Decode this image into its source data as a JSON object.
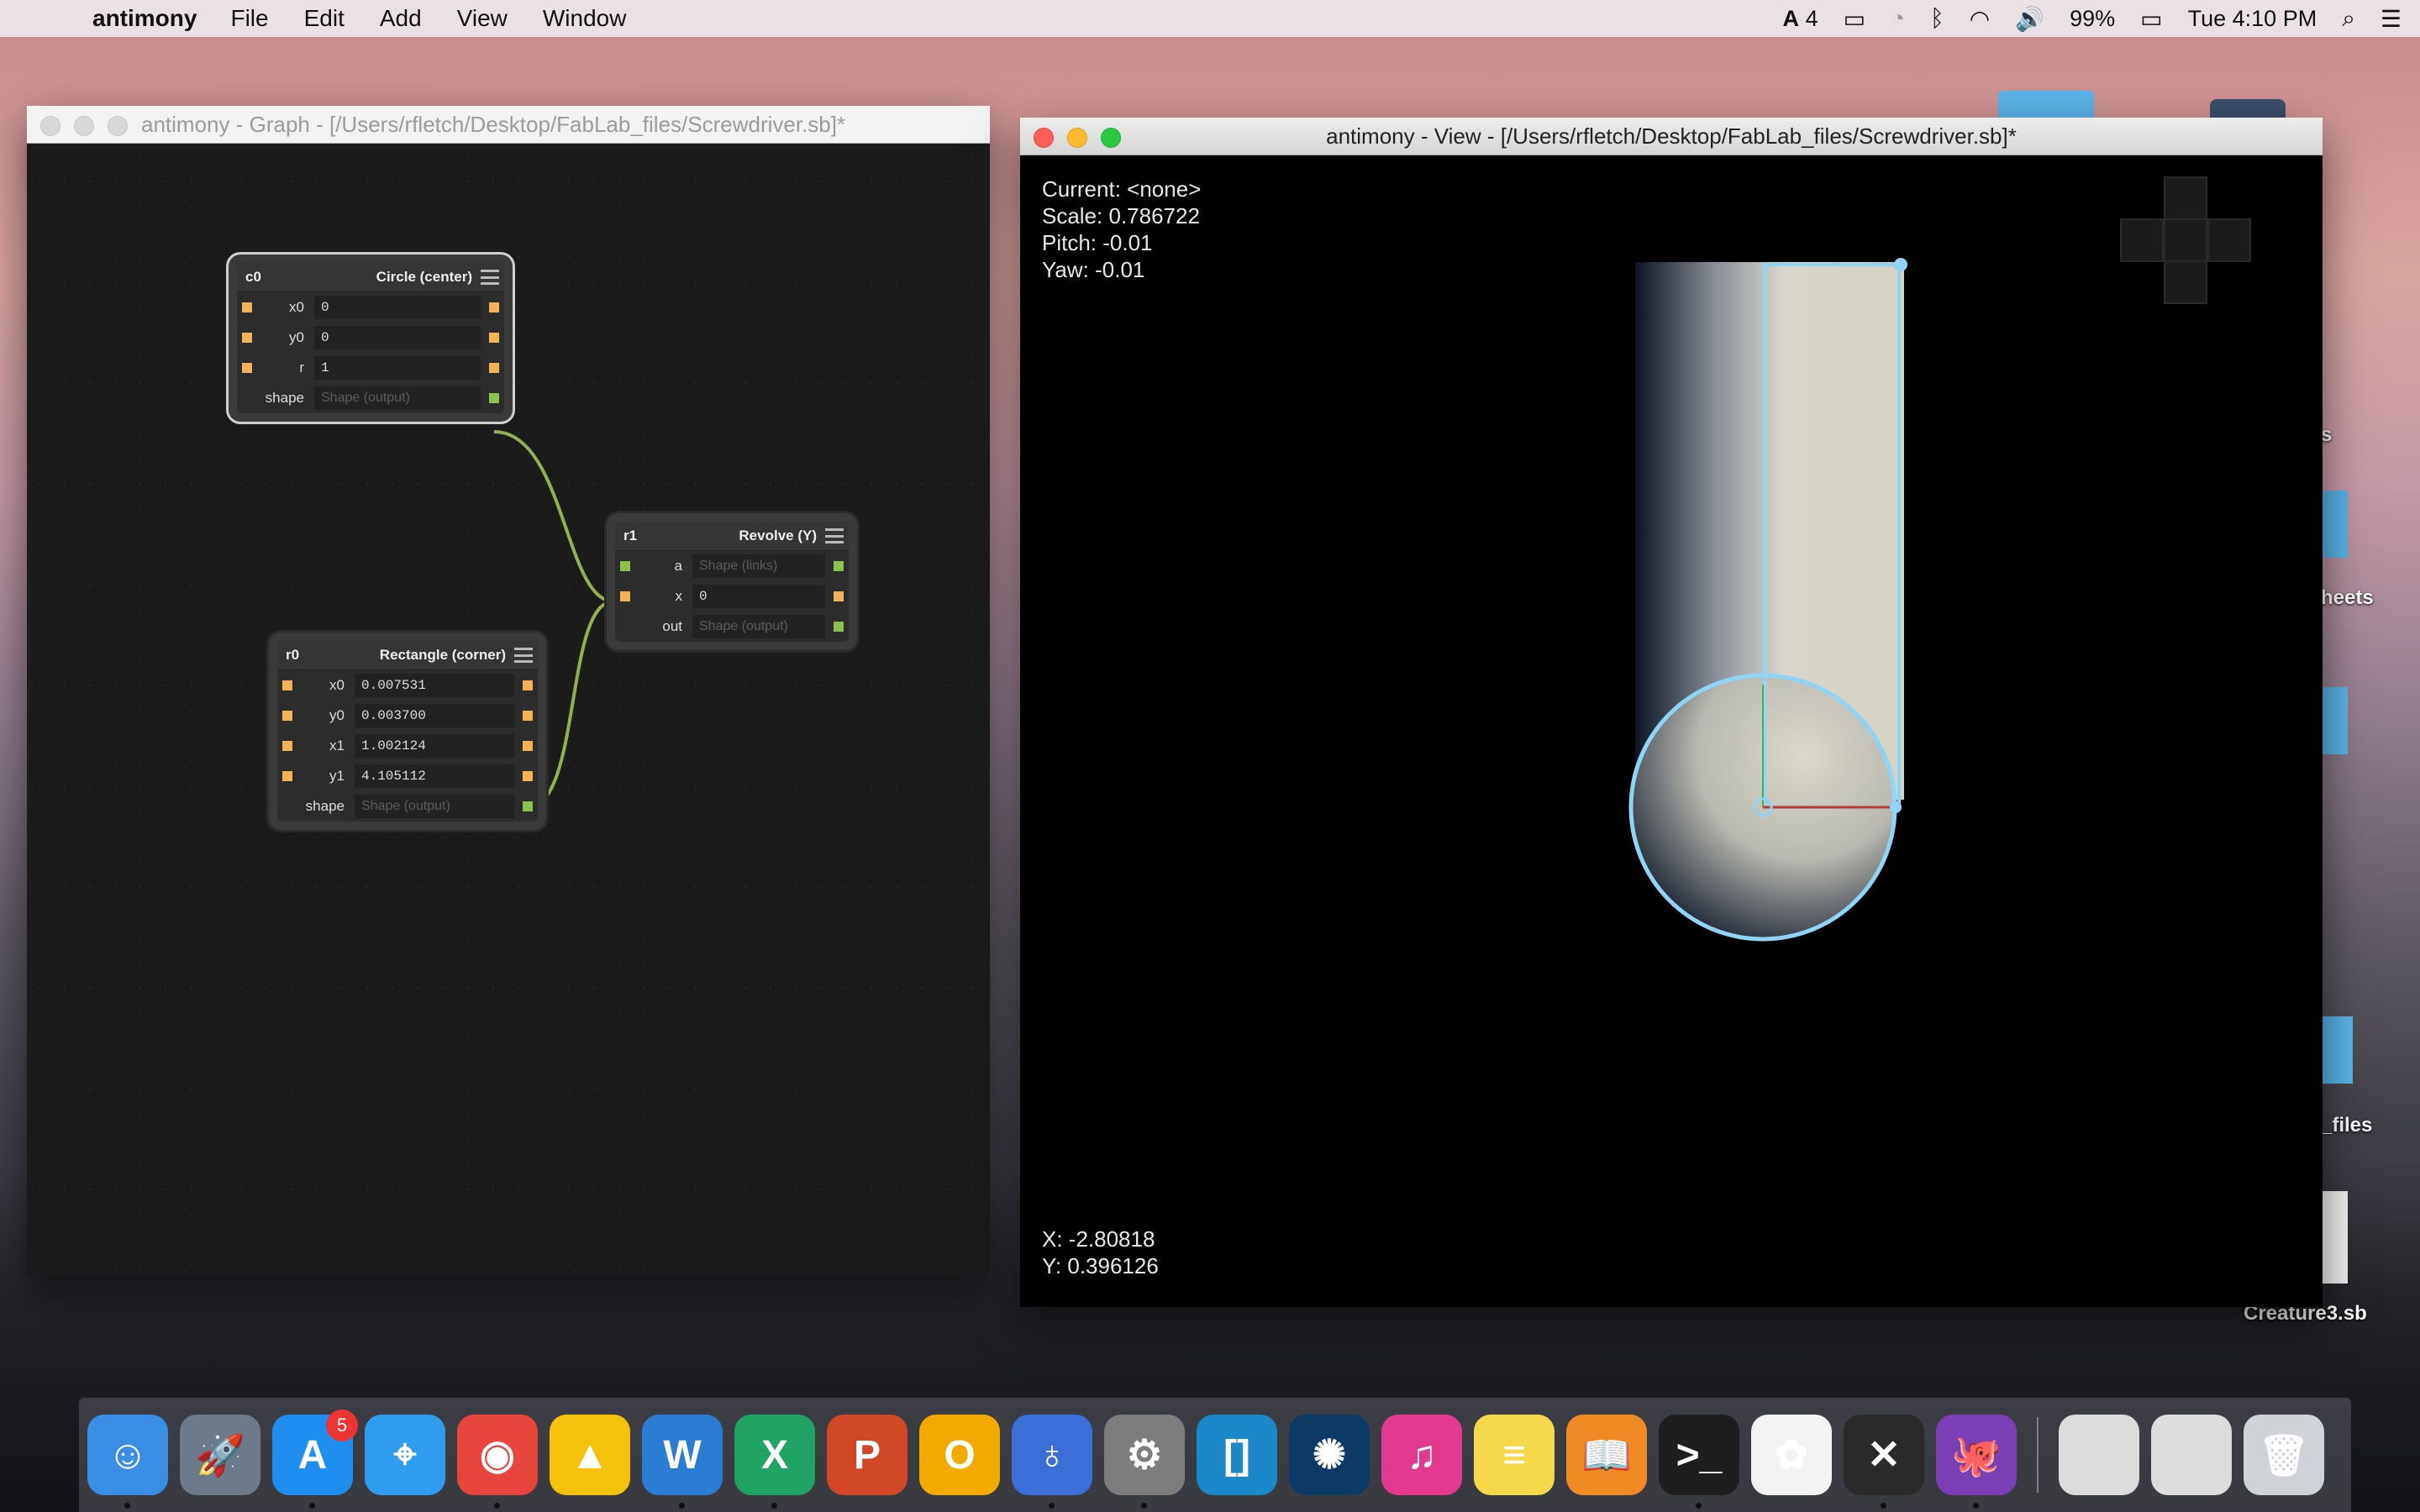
{
  "menubar": {
    "app_name": "antimony",
    "items": [
      "File",
      "Edit",
      "Add",
      "View",
      "Window"
    ],
    "status": {
      "adobe_count": "4",
      "battery": "99%",
      "clock": "Tue 4:10 PM"
    }
  },
  "graph_window": {
    "title": "antimony - Graph - [/Users/rfletch/Desktop/FabLab_files/Screwdriver.sb]*",
    "nodes": {
      "c0": {
        "name": "c0",
        "type": "Circle (center)",
        "rows": [
          {
            "label": "x0",
            "value": "0"
          },
          {
            "label": "y0",
            "value": "0"
          },
          {
            "label": "r",
            "value": "1"
          },
          {
            "label": "shape",
            "value": "Shape (output)"
          }
        ]
      },
      "r1": {
        "name": "r1",
        "type": "Revolve (Y)",
        "rows": [
          {
            "label": "a",
            "value": "Shape (links)"
          },
          {
            "label": "x",
            "value": "0"
          },
          {
            "label": "out",
            "value": "Shape (output)"
          }
        ]
      },
      "r0": {
        "name": "r0",
        "type": "Rectangle (corner)",
        "rows": [
          {
            "label": "x0",
            "value": "0.007531"
          },
          {
            "label": "y0",
            "value": "0.003700"
          },
          {
            "label": "x1",
            "value": "1.002124"
          },
          {
            "label": "y1",
            "value": "4.105112"
          },
          {
            "label": "shape",
            "value": "Shape (output)"
          }
        ]
      }
    }
  },
  "view_window": {
    "title": "antimony - View - [/Users/rfletch/Desktop/FabLab_files/Screwdriver.sb]*",
    "hud": {
      "current": "Current: <none>",
      "scale": "Scale: 0.786722",
      "pitch": "Pitch: -0.01",
      "yaw": "Yaw: -0.01"
    },
    "cursor": {
      "x": "X: -2.80818",
      "y": "Y: 0.396126"
    }
  },
  "desktop": {
    "labels": [
      "s",
      "heets",
      "_files",
      "Creature3.sb"
    ]
  },
  "dock": {
    "items": [
      {
        "name": "finder",
        "color": "#3a8ee6",
        "glyph": "☺"
      },
      {
        "name": "launchpad",
        "color": "#6c7a89",
        "glyph": "🚀"
      },
      {
        "name": "app-store",
        "color": "#1f8ef1",
        "glyph": "A",
        "badge": "5"
      },
      {
        "name": "safari",
        "color": "#2f9cf0",
        "glyph": "⌖"
      },
      {
        "name": "chrome",
        "color": "#e8453c",
        "glyph": "◉"
      },
      {
        "name": "google-drive",
        "color": "#f4c20d",
        "glyph": "▲"
      },
      {
        "name": "word",
        "color": "#2b7cd3",
        "glyph": "W"
      },
      {
        "name": "excel",
        "color": "#21a366",
        "glyph": "X"
      },
      {
        "name": "powerpoint",
        "color": "#d24726",
        "glyph": "P"
      },
      {
        "name": "outlook",
        "color": "#f2a900",
        "glyph": "O"
      },
      {
        "name": "antimony",
        "color": "#3a6fd8",
        "glyph": "♁"
      },
      {
        "name": "system-preferences",
        "color": "#7d7d7d",
        "glyph": "⚙"
      },
      {
        "name": "brackets",
        "color": "#1a88c9",
        "glyph": "[]"
      },
      {
        "name": "battle-net",
        "color": "#0b3a66",
        "glyph": "✺"
      },
      {
        "name": "itunes",
        "color": "#e3398e",
        "glyph": "♫"
      },
      {
        "name": "notes",
        "color": "#f5d94b",
        "glyph": "≡"
      },
      {
        "name": "ibooks",
        "color": "#f08a24",
        "glyph": "📖"
      },
      {
        "name": "terminal",
        "color": "#1e1e1e",
        "glyph": ">_"
      },
      {
        "name": "photos",
        "color": "#f3f3f3",
        "glyph": "✿"
      },
      {
        "name": "x11",
        "color": "#2a2a2a",
        "glyph": "✕"
      },
      {
        "name": "github-desktop",
        "color": "#7b3fb5",
        "glyph": "🐙"
      },
      {
        "name": "screenshot-thumb-1",
        "color": "#dcdcdc",
        "glyph": ""
      },
      {
        "name": "screenshot-thumb-2",
        "color": "#dcdcdc",
        "glyph": ""
      },
      {
        "name": "trash",
        "color": "#cfd2d6",
        "glyph": "🗑"
      }
    ]
  }
}
